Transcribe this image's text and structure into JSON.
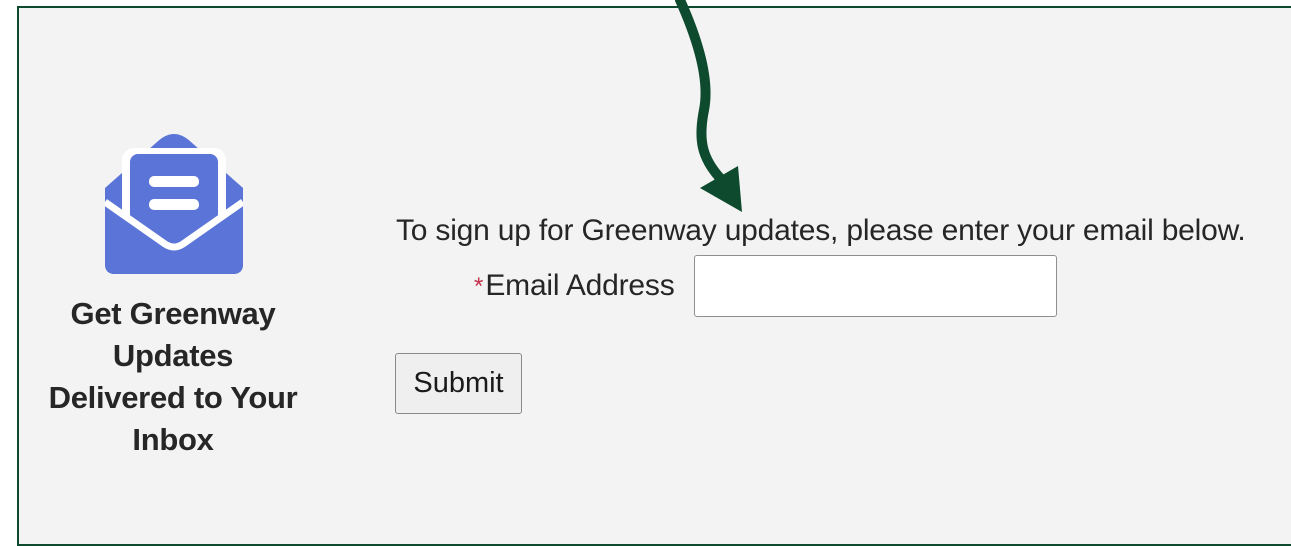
{
  "promo": {
    "icon": "open-envelope-with-letter-icon",
    "heading_lines": [
      "Get Greenway",
      "Updates",
      "Delivered to Your",
      "Inbox"
    ]
  },
  "form": {
    "instructions": "To sign up for Greenway updates, please enter your email below.",
    "required_marker": "*",
    "email_label": "Email Address",
    "email_value": "",
    "email_placeholder": "",
    "submit_label": "Submit"
  },
  "annotation": {
    "icon": "curved-arrow-down-icon"
  },
  "colors": {
    "panel_background": "#f3f3f3",
    "panel_border": "#0e4a2e",
    "icon_blue": "#5a74d8",
    "arrow_green": "#0e4a2e",
    "required_star": "#c4314b",
    "text": "#262626"
  }
}
